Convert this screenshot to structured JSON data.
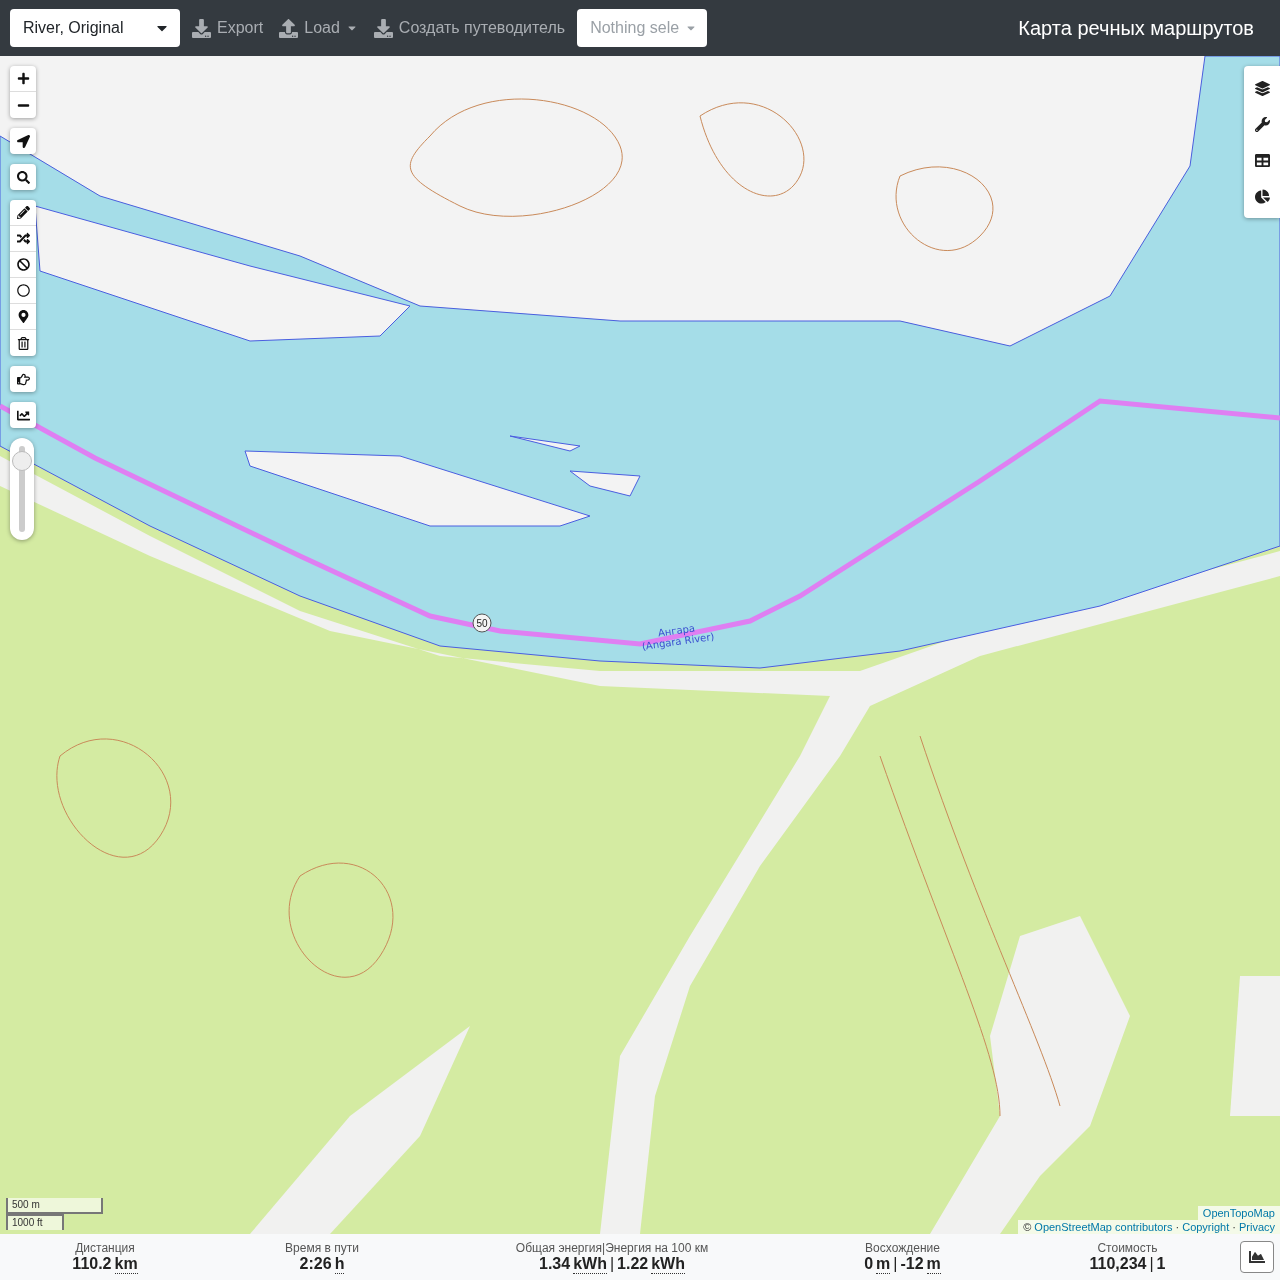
{
  "toolbar": {
    "profile_select": {
      "value": "River, Original"
    },
    "buttons": [
      {
        "label": "Export",
        "kind": "download"
      },
      {
        "label": "Load",
        "kind": "upload-menu"
      },
      {
        "label": "Создать путеводитель",
        "kind": "download"
      }
    ],
    "selection_select": {
      "placeholder": "Nothing sele"
    },
    "title": "Карта речных маршрутов"
  },
  "map": {
    "route_marker": "50",
    "river_label": [
      "Ангара",
      "(Angara River)"
    ],
    "zoom_slider": {
      "level": 0.85
    },
    "scale": [
      "500 m",
      "1000 ft"
    ],
    "attribution": {
      "source": "OpenTopoMap",
      "copyright_sign": "©",
      "contributors": "OpenStreetMap contributors",
      "separator": "·",
      "links": [
        "Copyright",
        "Privacy"
      ]
    }
  },
  "stats": [
    {
      "label": "Дистанция",
      "values": [
        {
          "value": "110.2",
          "unit": "km"
        }
      ]
    },
    {
      "label": "Время в пути",
      "values": [
        {
          "value": "2:26",
          "unit": "h"
        }
      ]
    },
    {
      "label": "Общая энергия|Энергия на 100 км",
      "separator": "|",
      "values": [
        {
          "value": "1.34",
          "unit": "kWh"
        },
        {
          "value": "1.22",
          "unit": "kWh"
        }
      ]
    },
    {
      "label": "Восхождение",
      "separator": "|",
      "values": [
        {
          "value": "0",
          "unit": "m"
        },
        {
          "value": "-12",
          "unit": "m"
        }
      ]
    },
    {
      "label": "Стоимость",
      "separator": "|",
      "values": [
        {
          "value": "110,234"
        },
        {
          "value": "1"
        }
      ]
    }
  ]
}
